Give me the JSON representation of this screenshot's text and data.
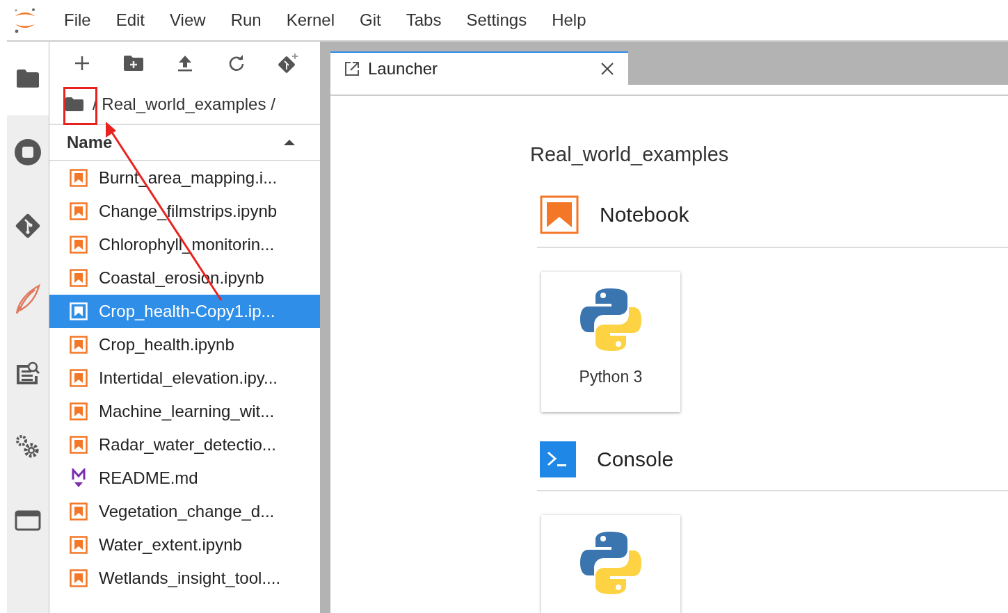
{
  "menu": [
    "File",
    "Edit",
    "View",
    "Run",
    "Kernel",
    "Git",
    "Tabs",
    "Settings",
    "Help"
  ],
  "rail": [
    {
      "kind": "folder",
      "selected": true
    },
    {
      "kind": "running",
      "selected": false
    },
    {
      "kind": "git",
      "selected": false
    },
    {
      "kind": "feather",
      "selected": false
    },
    {
      "kind": "inspector",
      "selected": false
    },
    {
      "kind": "gears",
      "selected": false
    },
    {
      "kind": "tabs",
      "selected": false
    }
  ],
  "file_browser": {
    "breadcrumb": "/ Real_world_examples /",
    "column": "Name",
    "files": [
      {
        "name": "Burnt_area_mapping.i...",
        "kind": "notebook",
        "selected": false
      },
      {
        "name": "Change_filmstrips.ipynb",
        "kind": "notebook",
        "selected": false
      },
      {
        "name": "Chlorophyll_monitorin...",
        "kind": "notebook",
        "selected": false
      },
      {
        "name": "Coastal_erosion.ipynb",
        "kind": "notebook",
        "selected": false
      },
      {
        "name": "Crop_health-Copy1.ip...",
        "kind": "notebook",
        "selected": true
      },
      {
        "name": "Crop_health.ipynb",
        "kind": "notebook",
        "selected": false
      },
      {
        "name": "Intertidal_elevation.ipy...",
        "kind": "notebook",
        "selected": false
      },
      {
        "name": "Machine_learning_wit...",
        "kind": "notebook",
        "selected": false
      },
      {
        "name": "Radar_water_detectio...",
        "kind": "notebook",
        "selected": false
      },
      {
        "name": "README.md",
        "kind": "markdown",
        "selected": false
      },
      {
        "name": "Vegetation_change_d...",
        "kind": "notebook",
        "selected": false
      },
      {
        "name": "Water_extent.ipynb",
        "kind": "notebook",
        "selected": false
      },
      {
        "name": "Wetlands_insight_tool....",
        "kind": "notebook",
        "selected": false
      }
    ]
  },
  "tabs": [
    {
      "label": "Launcher",
      "selected": true
    }
  ],
  "launcher": {
    "directory": "Real_world_examples",
    "sections": [
      {
        "title": "Notebook",
        "kind": "notebook",
        "cards": [
          {
            "kind": "python",
            "label": "Python 3"
          }
        ]
      },
      {
        "title": "Console",
        "kind": "console",
        "cards": [
          {
            "kind": "python"
          }
        ]
      }
    ]
  }
}
